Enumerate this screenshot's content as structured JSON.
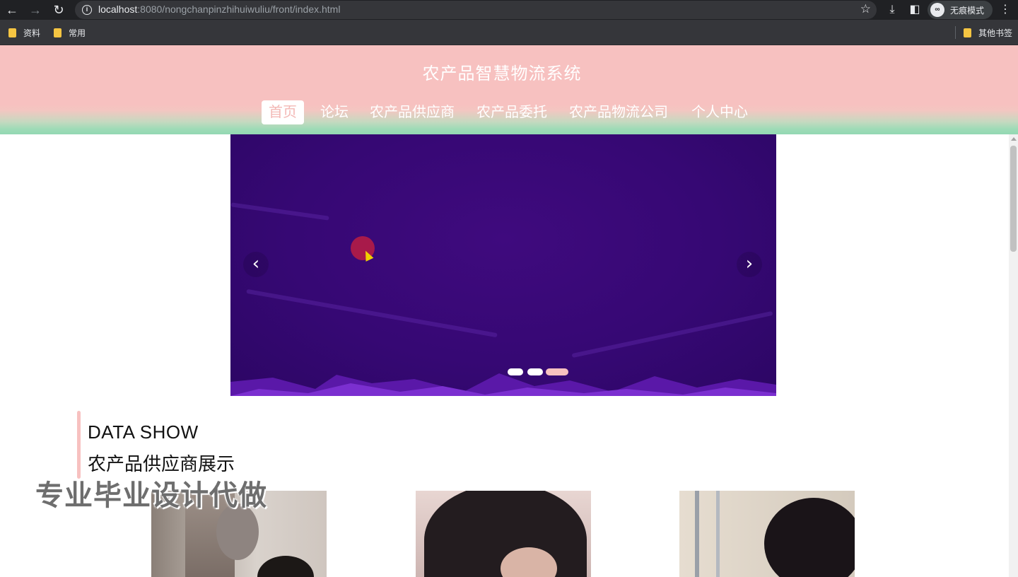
{
  "browser": {
    "url_host": "localhost",
    "url_rest": ":8080/nongchanpinzhihuiwuliu/front/index.html",
    "incognito_label": "无痕模式",
    "bookmarks": [
      "资料",
      "常用"
    ],
    "other_bookmarks": "其他书签"
  },
  "site": {
    "title": "农产品智慧物流系统",
    "nav": [
      "首页",
      "论坛",
      "农产品供应商",
      "农产品委托",
      "农产品物流公司",
      "个人中心"
    ],
    "active_nav": "首页"
  },
  "carousel": {
    "slide_count": 3,
    "active_index": 2,
    "prev_glyph": "‹",
    "next_glyph": "›"
  },
  "section": {
    "title_en": "DATA SHOW",
    "title_cn": "农产品供应商展示"
  },
  "watermark": "专业毕业设计代做",
  "colors": {
    "header_pink": "#f7c1c0",
    "header_green": "#93d8b3",
    "carousel_purple": "#360874",
    "accent": "#f7c1c0"
  }
}
